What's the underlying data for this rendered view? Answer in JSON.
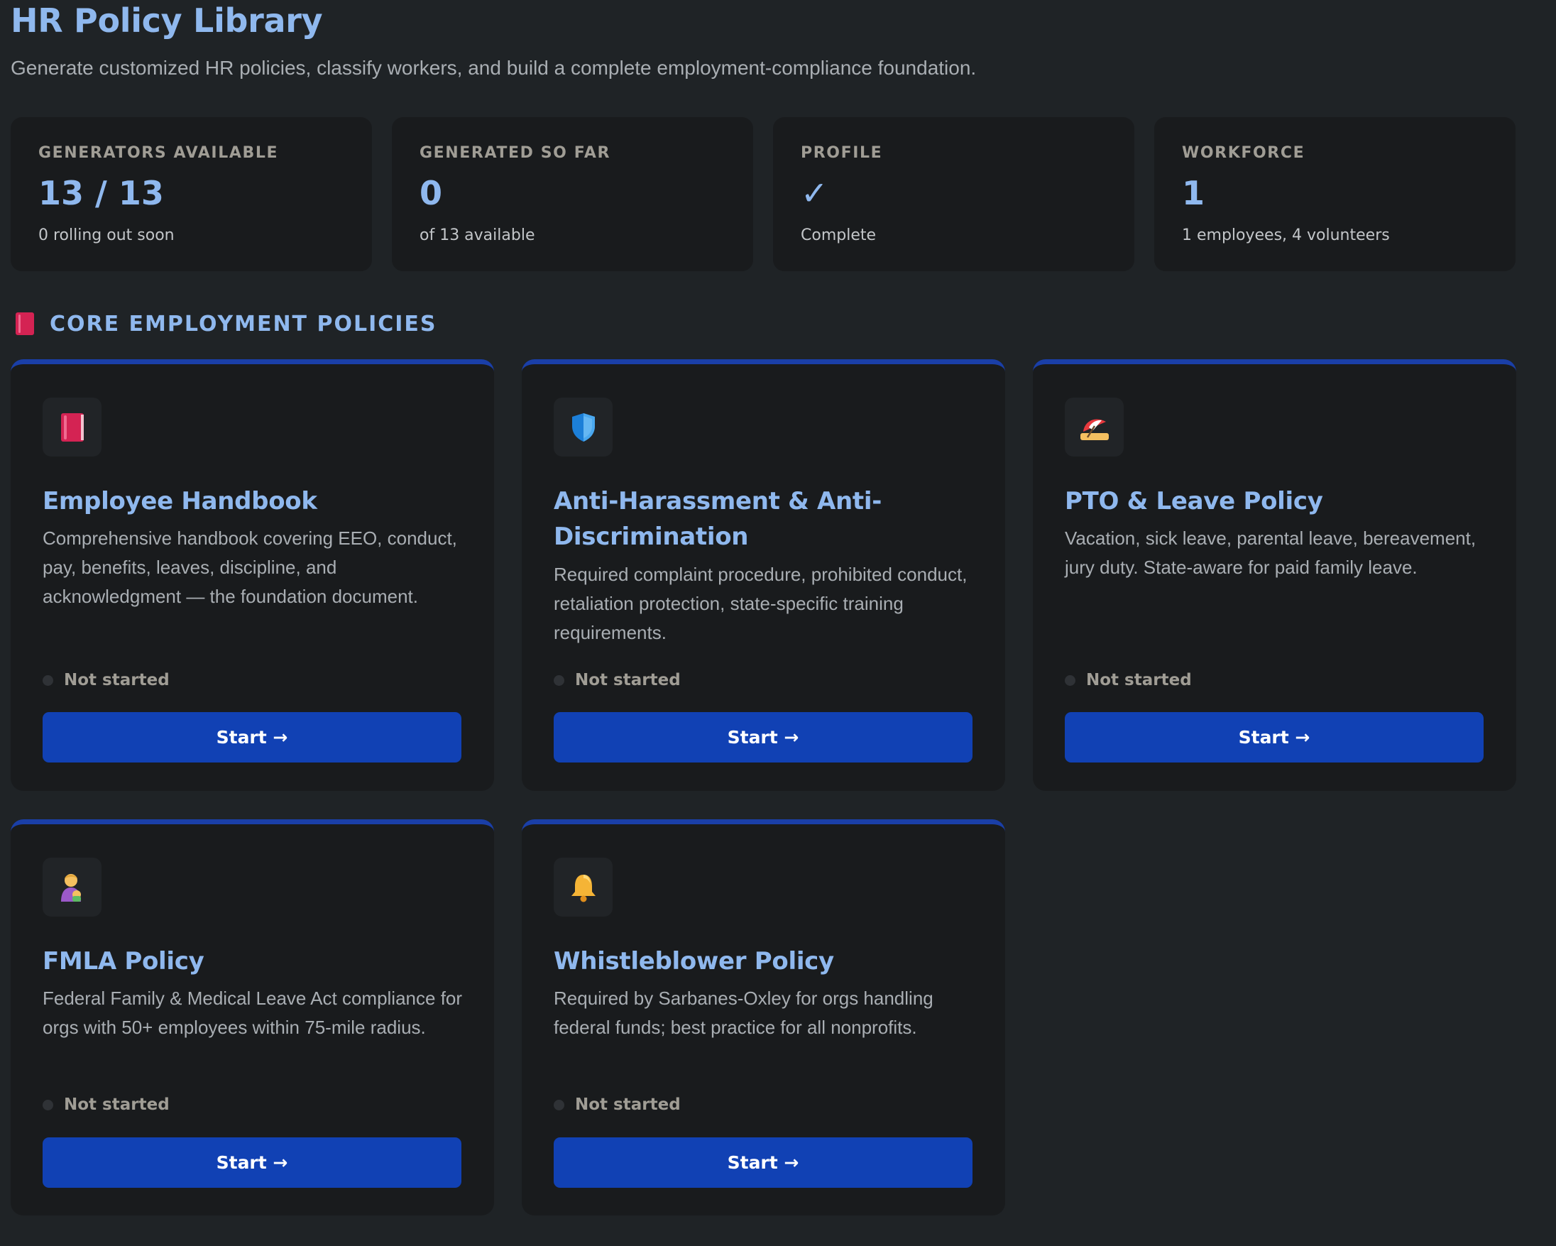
{
  "header": {
    "title": "HR Policy Library",
    "subtitle": "Generate customized HR policies, classify workers, and build a complete employment-compliance foundation."
  },
  "stats": [
    {
      "label": "GENERATORS AVAILABLE",
      "value": "13 / 13",
      "sub": "0 rolling out soon"
    },
    {
      "label": "GENERATED SO FAR",
      "value": "0",
      "sub": "of 13 available"
    },
    {
      "label": "PROFILE",
      "value": "✓",
      "sub": "Complete"
    },
    {
      "label": "WORKFORCE",
      "value": "1",
      "sub": "1 employees, 4 volunteers"
    }
  ],
  "section": {
    "icon": "book-icon",
    "title": "CORE EMPLOYMENT POLICIES"
  },
  "colors": {
    "background": "#1f2326",
    "card": "#191b1d",
    "accent": "#8fb8ee",
    "button": "#1141b4",
    "card_top_border": "#1a3fa8"
  },
  "policies": [
    {
      "icon": "book-icon",
      "title": "Employee Handbook",
      "description": "Comprehensive handbook covering EEO, conduct, pay, benefits, leaves, discipline, and acknowledgment — the foundation document.",
      "status": "Not started",
      "button": "Start →"
    },
    {
      "icon": "shield-icon",
      "title": "Anti-Harassment & Anti-Discrimination",
      "description": "Required complaint procedure, prohibited conduct, retaliation protection, state-specific training requirements.",
      "status": "Not started",
      "button": "Start →"
    },
    {
      "icon": "beach-umbrella-icon",
      "title": "PTO & Leave Policy",
      "description": "Vacation, sick leave, parental leave, bereavement, jury duty. State-aware for paid family leave.",
      "status": "Not started",
      "button": "Start →"
    },
    {
      "icon": "person-feeding-baby-icon",
      "title": "FMLA Policy",
      "description": "Federal Family & Medical Leave Act compliance for orgs with 50+ employees within 75-mile radius.",
      "status": "Not started",
      "button": "Start →"
    },
    {
      "icon": "bell-icon",
      "title": "Whistleblower Policy",
      "description": "Required by Sarbanes-Oxley for orgs handling federal funds; best practice for all nonprofits.",
      "status": "Not started",
      "button": "Start →"
    }
  ]
}
